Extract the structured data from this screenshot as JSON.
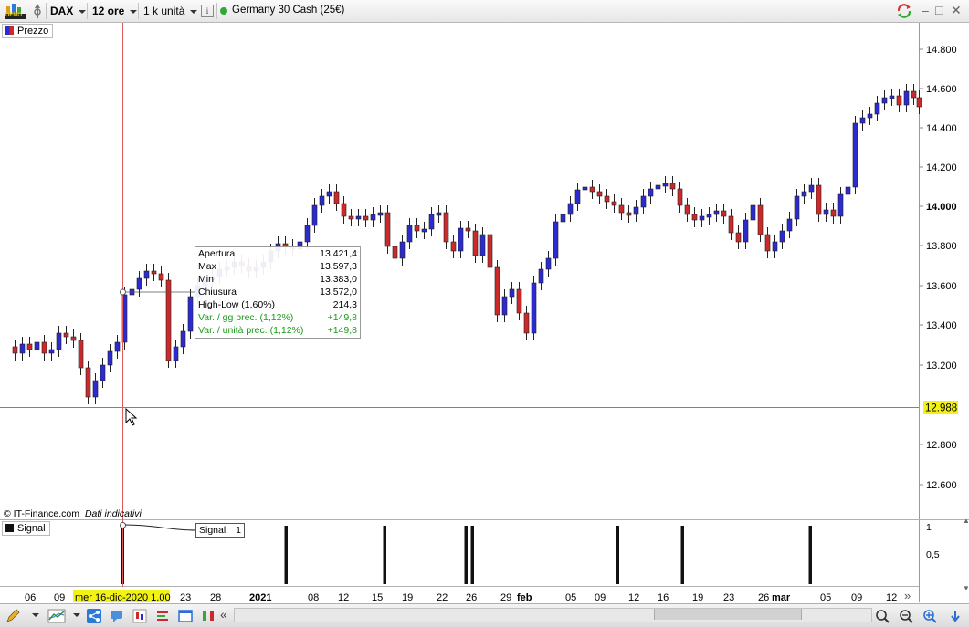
{
  "toolbar": {
    "demo_badge": "DEMO",
    "symbol": "DAX",
    "timeframe": "12 ore",
    "units": "1 k unità",
    "info_icon": "i",
    "instrument": "Germany 30 Cash (25€)",
    "status_color": "#2ea836"
  },
  "price_panel": {
    "legend_label": "Prezzo",
    "y_ticks": [
      "14.800",
      "14.600",
      "14.400",
      "14.200",
      "14.000",
      "13.800",
      "13.600",
      "13.400",
      "13.200",
      "12.800",
      "12.600"
    ],
    "crosshair_price": "12.988",
    "source_label": "© IT-Finance.com",
    "source_note": "Dati indicativi"
  },
  "tooltip": {
    "rows": [
      {
        "label": "Apertura",
        "value": "13.421,4"
      },
      {
        "label": "Max",
        "value": "13.597,3"
      },
      {
        "label": "Min",
        "value": "13.383,0"
      },
      {
        "label": "Chiusura",
        "value": "13.572,0"
      },
      {
        "label": "High-Low (1,60%)",
        "value": "214,3"
      },
      {
        "label": "Var. / gg prec. (1,12%)",
        "value": "+149,8"
      },
      {
        "label": "Var. / unità prec. (1,12%)",
        "value": "+149,8"
      }
    ]
  },
  "signal_panel": {
    "legend_label": "Signal",
    "callout_label": "Signal",
    "callout_value": "1",
    "y_ticks": [
      "1",
      "0,5"
    ]
  },
  "x_axis": {
    "labels": [
      "06",
      "09",
      "23",
      "28",
      "2021",
      "08",
      "12",
      "15",
      "19",
      "22",
      "26",
      "29",
      "feb",
      "05",
      "09",
      "12",
      "16",
      "19",
      "23",
      "26",
      "mar",
      "05",
      "09",
      "12"
    ],
    "crosshair_date": "mer 16-dic-2020 1.00"
  },
  "colors": {
    "bull": "#2b2bd0",
    "bear": "#cc2a2a",
    "crosshair": "#e05a5a",
    "price_tag_bg": "#f2f214"
  },
  "bottom_toolbar": {
    "nav_back": "«",
    "nav_forward": "»"
  }
}
